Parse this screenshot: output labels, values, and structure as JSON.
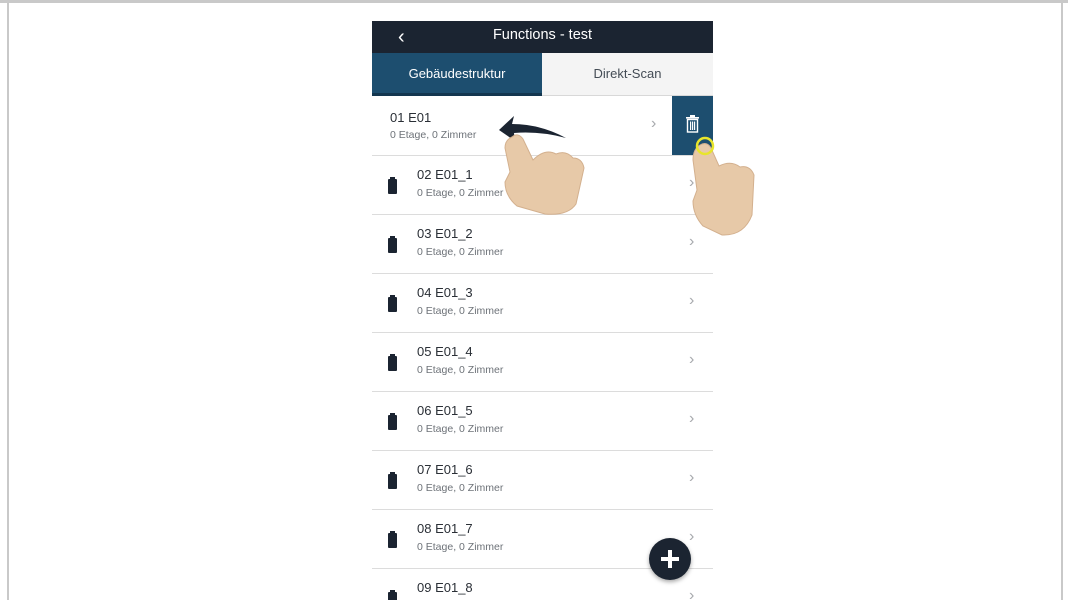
{
  "header": {
    "back_icon": "chevron-left-icon",
    "title": "Functions - test"
  },
  "tabs": [
    {
      "label": "Gebäudestruktur",
      "active": true
    },
    {
      "label": "Direkt-Scan",
      "active": false
    }
  ],
  "swiped_row": {
    "name": "01 E01",
    "subtitle": "0 Etage, 0 Zimmer",
    "action_icon": "trash-icon"
  },
  "rows": [
    {
      "name": "02 E01_1",
      "subtitle": "0 Etage, 0 Zimmer"
    },
    {
      "name": "03 E01_2",
      "subtitle": "0 Etage, 0 Zimmer"
    },
    {
      "name": "04 E01_3",
      "subtitle": "0 Etage, 0 Zimmer"
    },
    {
      "name": "05 E01_4",
      "subtitle": "0 Etage, 0 Zimmer"
    },
    {
      "name": "06 E01_5",
      "subtitle": "0 Etage, 0 Zimmer"
    },
    {
      "name": "07 E01_6",
      "subtitle": "0 Etage, 0 Zimmer"
    },
    {
      "name": "08 E01_7",
      "subtitle": "0 Etage, 0 Zimmer"
    },
    {
      "name": "09 E01_8",
      "subtitle": ""
    }
  ],
  "fab_icon": "plus-icon",
  "colors": {
    "header_bg": "#1b2431",
    "tab_active_bg": "#1d4e6f",
    "delete_bg": "#1d4e6f",
    "highlight": "#e8e52b",
    "hand": "#e7c9a8"
  }
}
